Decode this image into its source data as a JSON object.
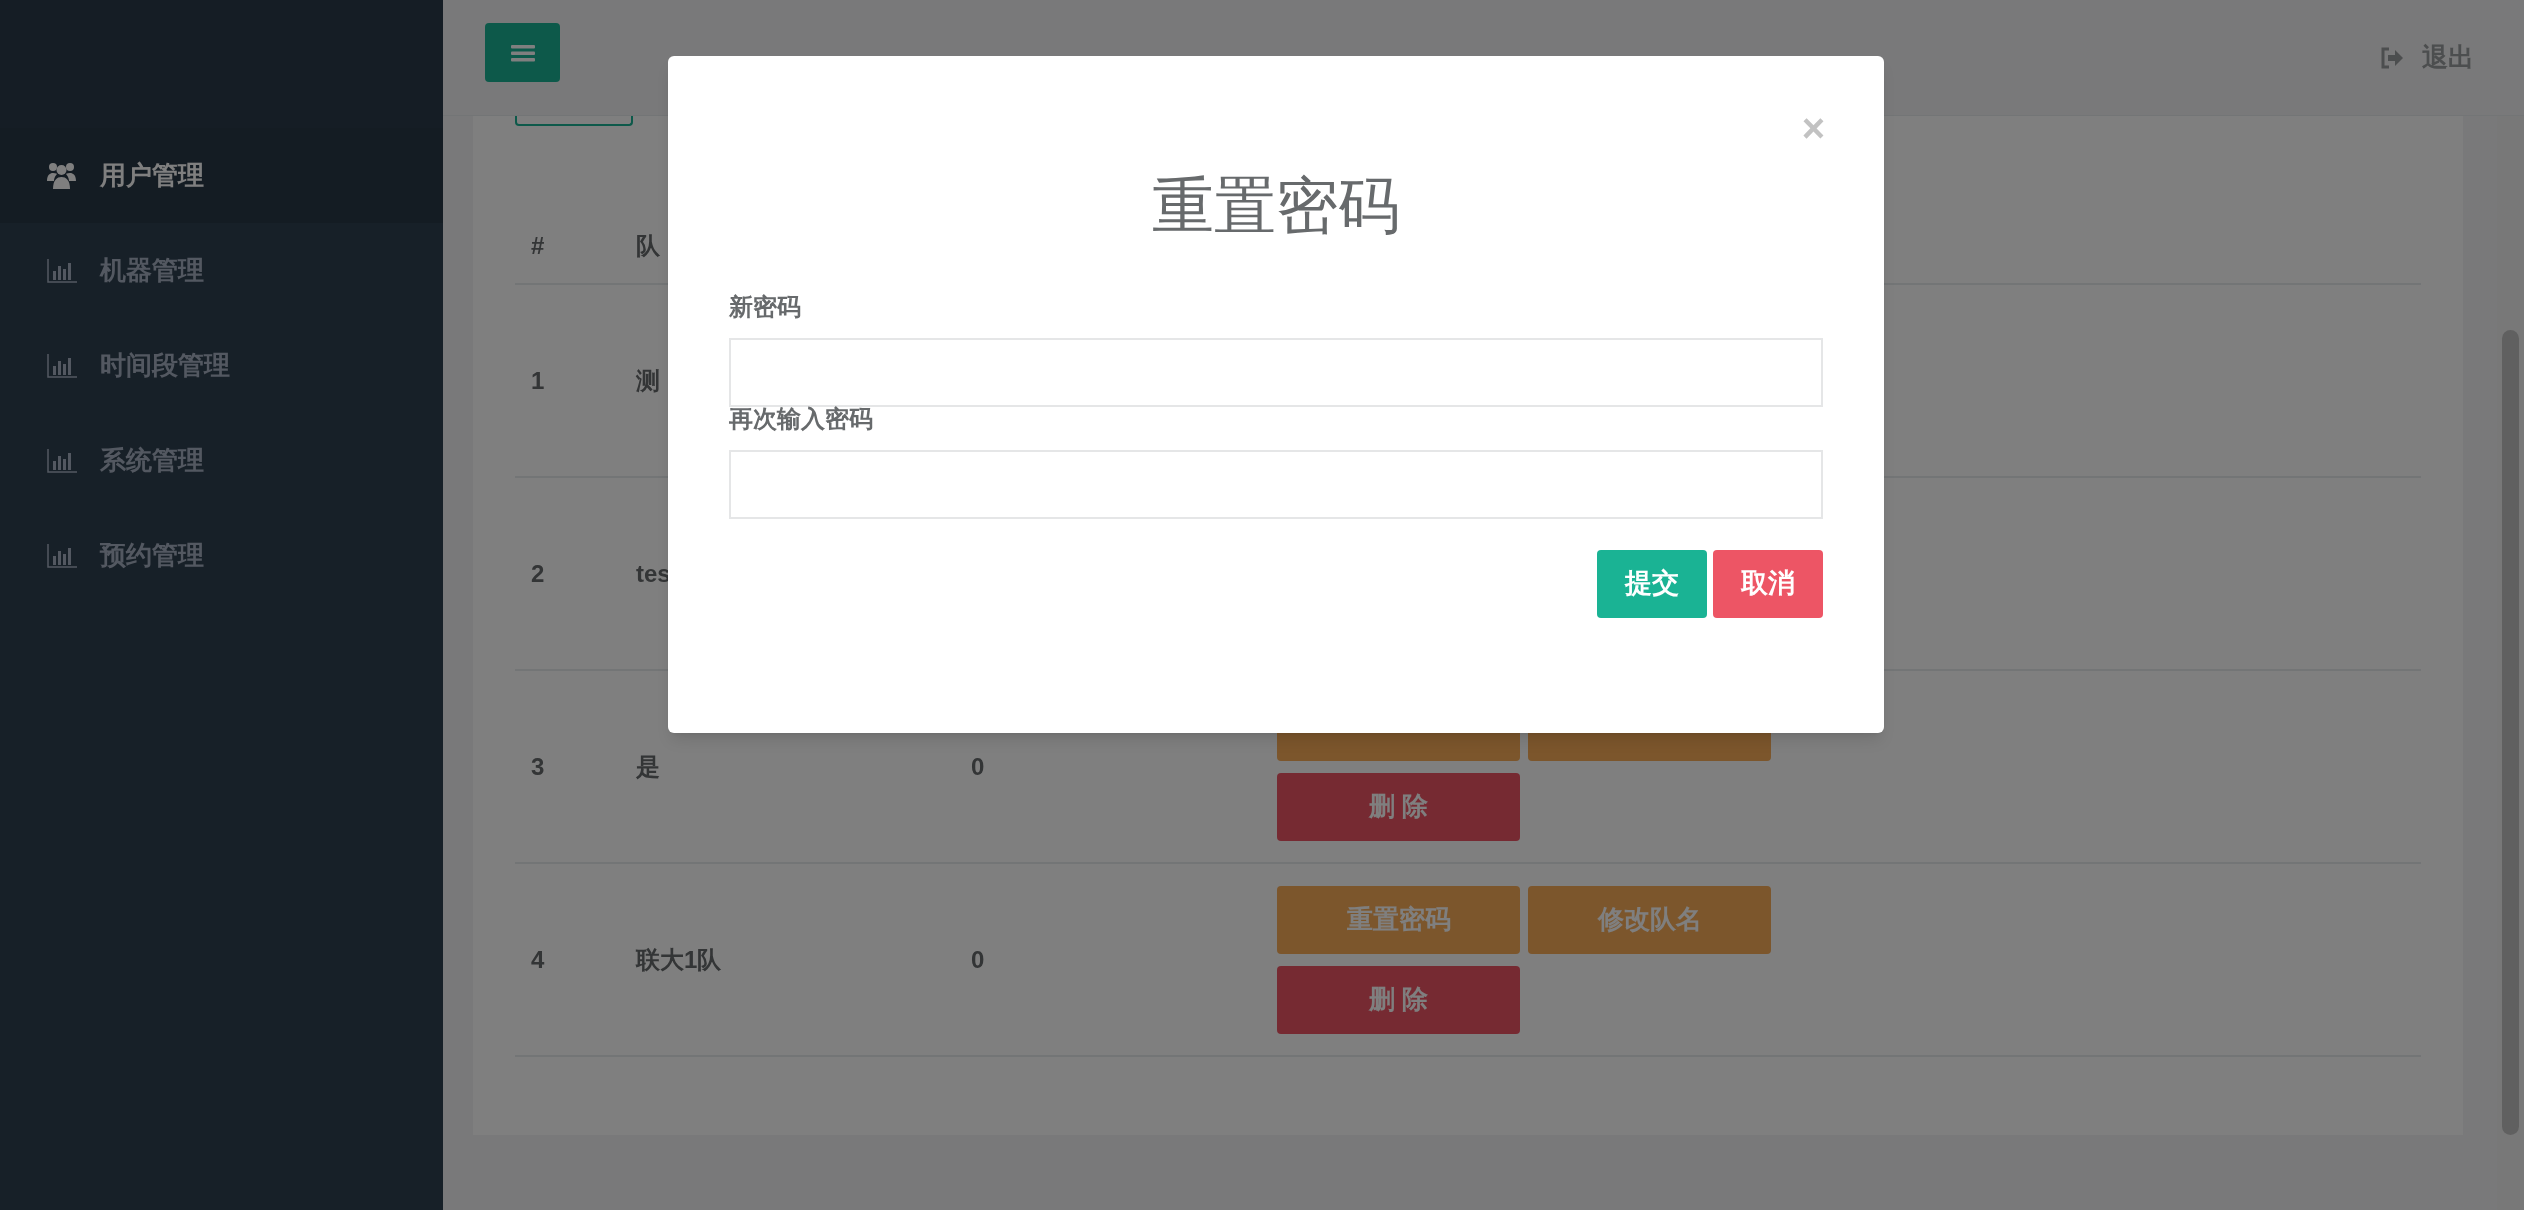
{
  "sidebar": {
    "items": [
      {
        "kind": "users",
        "label": "用户管理",
        "selected": true
      },
      {
        "kind": "chart",
        "label": "机器管理",
        "selected": false
      },
      {
        "kind": "chart",
        "label": "时间段管理",
        "selected": false
      },
      {
        "kind": "chart",
        "label": "系统管理",
        "selected": false
      },
      {
        "kind": "chart",
        "label": "预约管理",
        "selected": false
      }
    ]
  },
  "header": {
    "logout": "退出"
  },
  "table": {
    "columns": [
      "#",
      "队"
    ],
    "rows": [
      {
        "index": "1",
        "name": "测"
      },
      {
        "index": "2",
        "name": "tes"
      },
      {
        "index": "3",
        "name": "是",
        "count": "0",
        "actions": [
          {
            "kind": "warning"
          },
          {
            "kind": "warning"
          },
          {
            "kind": "danger",
            "label": "删 除"
          }
        ]
      },
      {
        "index": "4",
        "name": "联大1队",
        "count": "0",
        "actions": [
          {
            "kind": "warning",
            "label": "重置密码"
          },
          {
            "kind": "warning",
            "label": "修改队名"
          },
          {
            "kind": "danger",
            "label": "删 除"
          }
        ]
      }
    ]
  },
  "modal": {
    "close": "×",
    "title": "重置密码",
    "fields": [
      {
        "label": "新密码"
      },
      {
        "label": "再次输入密码"
      }
    ],
    "buttons": [
      {
        "kind": "primary",
        "label": "提交"
      },
      {
        "kind": "danger",
        "label": "取消"
      }
    ]
  }
}
